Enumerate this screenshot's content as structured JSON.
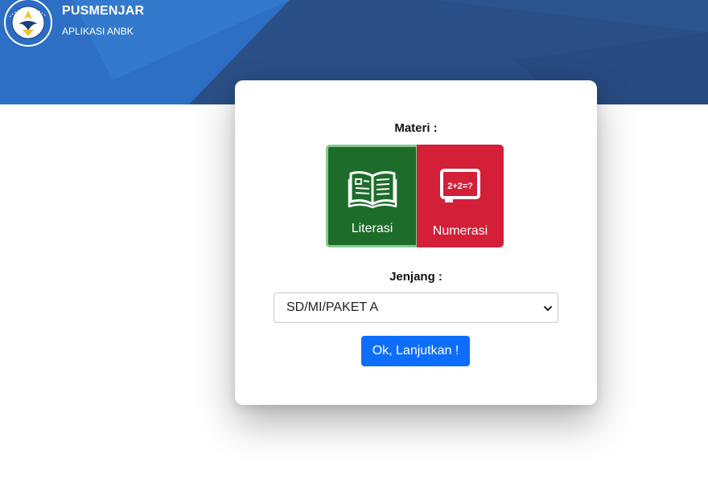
{
  "header": {
    "title": "PUSMENJAR",
    "subtitle": "APLIKASI ANBK",
    "logo_icon": "tut-wuri-handayani-logo-icon",
    "colors": {
      "banner": "#2a4f86",
      "banner_highlight": "#2c6fc4"
    }
  },
  "materi": {
    "label": "Materi :",
    "options": [
      {
        "label": "Literasi",
        "icon": "open-book-icon",
        "color": "#1e6c2a",
        "selected": true
      },
      {
        "label": "Numerasi",
        "icon": "math-board-icon",
        "icon_text": "2+2=?",
        "color": "#d31f38",
        "selected": false
      }
    ]
  },
  "jenjang": {
    "label": "Jenjang :",
    "selected_value": "SD/MI/PAKET A"
  },
  "submit": {
    "label": "Ok, Lanjutkan !",
    "color": "#0d6efd"
  }
}
